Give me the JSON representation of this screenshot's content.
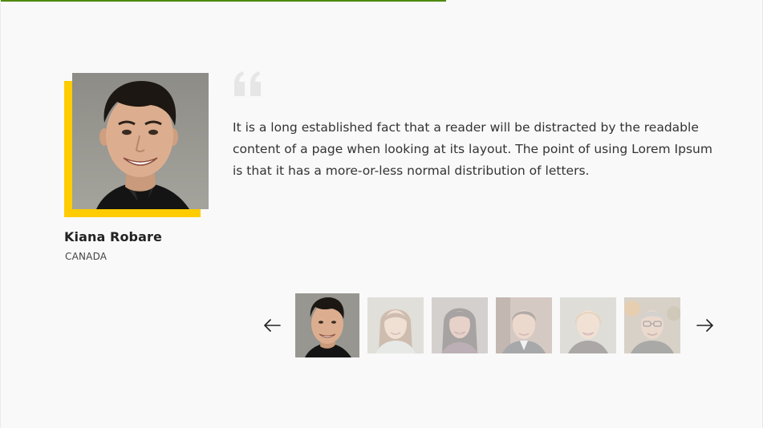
{
  "testimonial": {
    "name": "Kiana Robare",
    "country": "CANADA",
    "quote": "It is a long established fact that a reader will be distracted by the readable content of a page when looking at its layout. The point of using Lorem Ipsum is that it has a more-or-less normal distribution of letters.",
    "quote_icon": "quote-icon"
  },
  "progress": {
    "value": 0.585,
    "color": "#4f8a10"
  },
  "colors": {
    "accent": "#ffcc00",
    "background": "#f9f9f9",
    "text": "#333333"
  },
  "carousel": {
    "prev_icon": "arrow-left-icon",
    "next_icon": "arrow-right-icon",
    "active_index": 0,
    "thumbnail_count": 6
  }
}
